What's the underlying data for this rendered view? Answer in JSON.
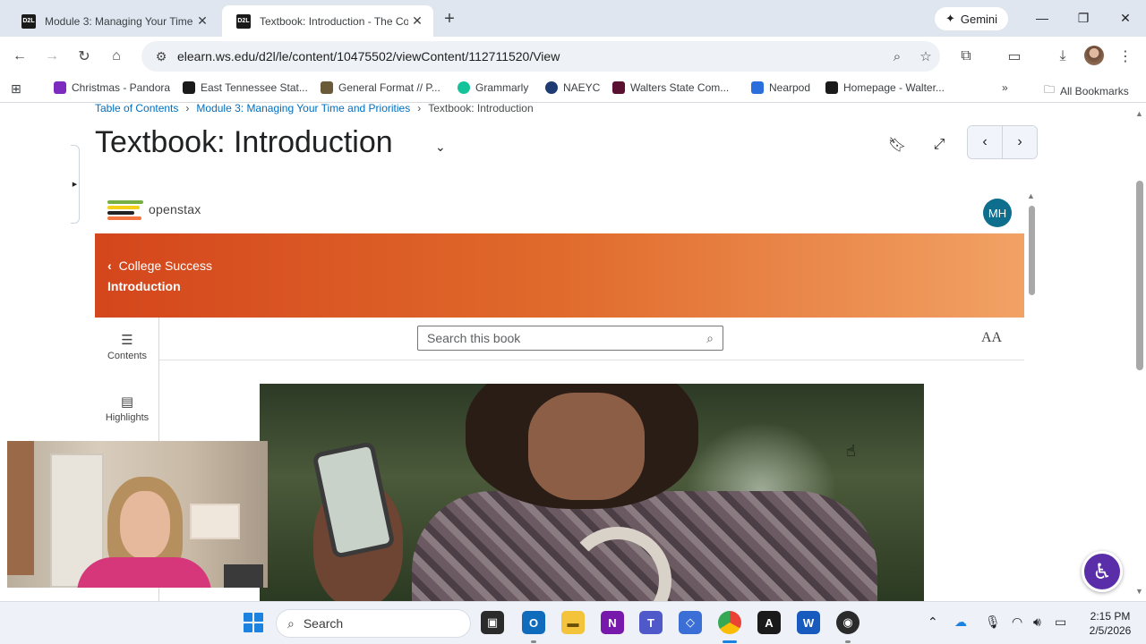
{
  "browser": {
    "tabs": [
      {
        "favicon": "D2L",
        "title": "Module 3: Managing Your Time",
        "active": false
      },
      {
        "favicon": "D2L",
        "title": "Textbook: Introduction - The Co",
        "active": true
      }
    ],
    "gemini_label": "Gemini",
    "url": "elearn.ws.edu/d2l/le/content/10475502/viewContent/112711520/View",
    "bookmarks": [
      {
        "label": "Christmas - Pandora",
        "color": "#7b2cbf"
      },
      {
        "label": "East Tennessee Stat...",
        "color": "#1a1a1a"
      },
      {
        "label": "General Format // P...",
        "color": "#6b5a3a"
      },
      {
        "label": "Grammarly",
        "color": "#15c39a"
      },
      {
        "label": "NAEYC",
        "color": "#1f3b73"
      },
      {
        "label": "Walters State Com...",
        "color": "#5a1030"
      },
      {
        "label": "Nearpod",
        "color": "#2a6fdb"
      },
      {
        "label": "Homepage - Walter...",
        "color": "#1a1a1a"
      }
    ],
    "all_bookmarks": "All Bookmarks"
  },
  "d2l": {
    "breadcrumb": [
      "Table of Contents",
      "Module 3: Managing Your Time and Priorities",
      "Textbook: Introduction"
    ],
    "title": "Textbook: Introduction"
  },
  "openstax": {
    "brand": "openstax",
    "user_initials": "MH",
    "book": "College Success",
    "chapter": "Introduction",
    "sidebar": [
      {
        "label": "Contents",
        "icon": "list-icon"
      },
      {
        "label": "Highlights",
        "icon": "highlights-icon"
      }
    ],
    "search_placeholder": "Search this book",
    "text_size_label": "AA"
  },
  "taskbar": {
    "search_label": "Search",
    "time": "2:15 PM",
    "date": "2/5/2026"
  },
  "colors": {
    "banner_start": "#d4461c",
    "banner_end": "#f2a265",
    "accessibility": "#5a2ea8",
    "d2l_link": "#006fbf"
  }
}
